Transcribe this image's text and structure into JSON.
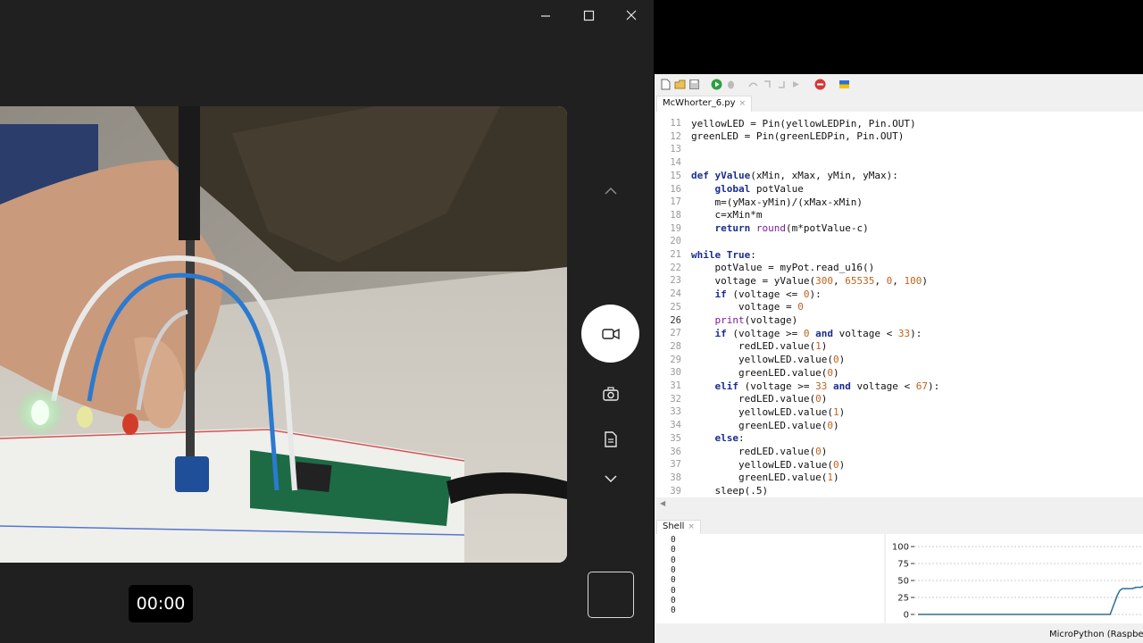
{
  "camera": {
    "window_controls": {
      "minimize": "minimize-icon",
      "maximize": "maximize-icon",
      "close": "close-icon"
    },
    "timer": "00:00",
    "record_color": "#ffffff"
  },
  "ide": {
    "toolbar_icons": [
      "new-file-icon",
      "open-file-icon",
      "save-icon",
      "run-icon",
      "debug-icon",
      "step-over-icon",
      "step-into-icon",
      "step-out-icon",
      "resume-icon",
      "stop-icon",
      "ukraine-flag-icon"
    ],
    "editor_tab": "McWhorter_6.py",
    "current_line": 26,
    "code_lines": [
      {
        "n": "11",
        "segs": [
          [
            "",
            "yellowLED = Pin(yellowLEDPin, Pin.OUT)"
          ]
        ]
      },
      {
        "n": "12",
        "segs": [
          [
            "",
            "greenLED = Pin(greenLEDPin, Pin.OUT)"
          ]
        ]
      },
      {
        "n": "13",
        "segs": []
      },
      {
        "n": "14",
        "segs": []
      },
      {
        "n": "15",
        "segs": [
          [
            "kw",
            "def "
          ],
          [
            "kw",
            "yValue"
          ],
          [
            "",
            "(xMin, xMax, yMin, yMax):"
          ]
        ]
      },
      {
        "n": "16",
        "segs": [
          [
            "",
            "    "
          ],
          [
            "kw",
            "global"
          ],
          [
            "",
            " potValue"
          ]
        ]
      },
      {
        "n": "17",
        "segs": [
          [
            "",
            "    m=(yMax-yMin)/(xMax-xMin)"
          ]
        ]
      },
      {
        "n": "18",
        "segs": [
          [
            "",
            "    c=xMin*m"
          ]
        ]
      },
      {
        "n": "19",
        "segs": [
          [
            "",
            "    "
          ],
          [
            "kw",
            "return"
          ],
          [
            "",
            " "
          ],
          [
            "bi",
            "round"
          ],
          [
            "",
            "(m*potValue-c)"
          ]
        ]
      },
      {
        "n": "20",
        "segs": []
      },
      {
        "n": "21",
        "segs": [
          [
            "kw",
            "while"
          ],
          [
            "",
            " "
          ],
          [
            "kw",
            "True"
          ],
          [
            "",
            ":"
          ]
        ]
      },
      {
        "n": "22",
        "segs": [
          [
            "",
            "    potValue = myPot.read_u16()"
          ]
        ]
      },
      {
        "n": "23",
        "segs": [
          [
            "",
            "    voltage = yValue("
          ],
          [
            "num",
            "300"
          ],
          [
            "",
            ", "
          ],
          [
            "num",
            "65535"
          ],
          [
            "",
            ", "
          ],
          [
            "num",
            "0"
          ],
          [
            "",
            ", "
          ],
          [
            "num",
            "100"
          ],
          [
            "",
            ")"
          ]
        ]
      },
      {
        "n": "24",
        "segs": [
          [
            "",
            "    "
          ],
          [
            "kw",
            "if"
          ],
          [
            "",
            " (voltage <= "
          ],
          [
            "num",
            "0"
          ],
          [
            "",
            "):"
          ]
        ]
      },
      {
        "n": "25",
        "segs": [
          [
            "",
            "        voltage = "
          ],
          [
            "num",
            "0"
          ]
        ]
      },
      {
        "n": "26",
        "segs": [
          [
            "",
            "    "
          ],
          [
            "bi",
            "print"
          ],
          [
            "",
            "(voltage)"
          ]
        ]
      },
      {
        "n": "27",
        "segs": [
          [
            "",
            "    "
          ],
          [
            "kw",
            "if"
          ],
          [
            "",
            " (voltage >= "
          ],
          [
            "num",
            "0"
          ],
          [
            "",
            " "
          ],
          [
            "kw",
            "and"
          ],
          [
            "",
            " voltage < "
          ],
          [
            "num",
            "33"
          ],
          [
            "",
            "):"
          ]
        ]
      },
      {
        "n": "28",
        "segs": [
          [
            "",
            "        redLED.value("
          ],
          [
            "num",
            "1"
          ],
          [
            "",
            ")"
          ]
        ]
      },
      {
        "n": "29",
        "segs": [
          [
            "",
            "        yellowLED.value("
          ],
          [
            "num",
            "0"
          ],
          [
            "",
            ")"
          ]
        ]
      },
      {
        "n": "30",
        "segs": [
          [
            "",
            "        greenLED.value("
          ],
          [
            "num",
            "0"
          ],
          [
            "",
            ")"
          ]
        ]
      },
      {
        "n": "31",
        "segs": [
          [
            "",
            "    "
          ],
          [
            "kw",
            "elif"
          ],
          [
            "",
            " (voltage >= "
          ],
          [
            "num",
            "33"
          ],
          [
            "",
            " "
          ],
          [
            "kw",
            "and"
          ],
          [
            "",
            " voltage < "
          ],
          [
            "num",
            "67"
          ],
          [
            "",
            "):"
          ]
        ]
      },
      {
        "n": "32",
        "segs": [
          [
            "",
            "        redLED.value("
          ],
          [
            "num",
            "0"
          ],
          [
            "",
            ")"
          ]
        ]
      },
      {
        "n": "33",
        "segs": [
          [
            "",
            "        yellowLED.value("
          ],
          [
            "num",
            "1"
          ],
          [
            "",
            ")"
          ]
        ]
      },
      {
        "n": "34",
        "segs": [
          [
            "",
            "        greenLED.value("
          ],
          [
            "num",
            "0"
          ],
          [
            "",
            ")"
          ]
        ]
      },
      {
        "n": "35",
        "segs": [
          [
            "",
            "    "
          ],
          [
            "kw",
            "else"
          ],
          [
            "",
            ":"
          ]
        ]
      },
      {
        "n": "36",
        "segs": [
          [
            "",
            "        redLED.value("
          ],
          [
            "num",
            "0"
          ],
          [
            "",
            ")"
          ]
        ]
      },
      {
        "n": "37",
        "segs": [
          [
            "",
            "        yellowLED.value("
          ],
          [
            "num",
            "0"
          ],
          [
            "",
            ")"
          ]
        ]
      },
      {
        "n": "38",
        "segs": [
          [
            "",
            "        greenLED.value("
          ],
          [
            "num",
            "1"
          ],
          [
            "",
            ")"
          ]
        ]
      },
      {
        "n": "39",
        "segs": [
          [
            "",
            "    sleep(.5)"
          ]
        ]
      }
    ],
    "shell_tab": "Shell",
    "shell_output": [
      "0",
      "0",
      "0",
      "0",
      "0",
      "0",
      "0",
      "0"
    ],
    "plotter": {
      "y_ticks": [
        100,
        75,
        50,
        25,
        0
      ],
      "ylim": [
        0,
        100
      ],
      "line_color": "#2e6f8e",
      "values": [
        0,
        0,
        0,
        0,
        0,
        0,
        0,
        0,
        0,
        0,
        0,
        0,
        0,
        0,
        0,
        0,
        0,
        0,
        0,
        0,
        0,
        0,
        0,
        0,
        0,
        0,
        0,
        0,
        0,
        0,
        0,
        0,
        0,
        0,
        0,
        0,
        0,
        0,
        0,
        0,
        0,
        0,
        0,
        0,
        0,
        0,
        0,
        0,
        0,
        0,
        0,
        0,
        0,
        0,
        0,
        0,
        0,
        0,
        0,
        0,
        0,
        0,
        0,
        0,
        0,
        0,
        0,
        0,
        0,
        0,
        0,
        0,
        0,
        0,
        0,
        0,
        0,
        0,
        0,
        0,
        0,
        0,
        0,
        0,
        0,
        0,
        0,
        0,
        0,
        0,
        0,
        0,
        0,
        0,
        0,
        0,
        0,
        0,
        0,
        0,
        0,
        0,
        0,
        0,
        0,
        0,
        0,
        0,
        0,
        0,
        0,
        0,
        0,
        0,
        0,
        0,
        0,
        0,
        0,
        0,
        0,
        0,
        0,
        0,
        0,
        0,
        0,
        0,
        0,
        0,
        0,
        0,
        0,
        0,
        0,
        0,
        0,
        0,
        0,
        0,
        0,
        0,
        0,
        0,
        0,
        0,
        0,
        0,
        0,
        0,
        0,
        0,
        0,
        0,
        0,
        0,
        0,
        0,
        0,
        0,
        0,
        0,
        0,
        0,
        0,
        0,
        0,
        0,
        0,
        0,
        0,
        0,
        0,
        0,
        0,
        0,
        0,
        0,
        0,
        0,
        0,
        0,
        0,
        0,
        0,
        0,
        0,
        0,
        4,
        8,
        12,
        16,
        20,
        24,
        28,
        31,
        34,
        36,
        37,
        38,
        38,
        38,
        38,
        38,
        38,
        38,
        38,
        38,
        38,
        38,
        39,
        39,
        40,
        40,
        40,
        40,
        40,
        40,
        41,
        41
      ]
    },
    "status": "MicroPython (Raspberry"
  }
}
